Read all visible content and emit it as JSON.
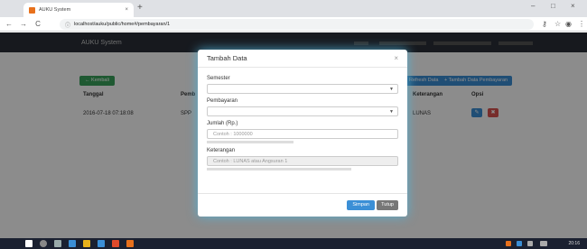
{
  "browser": {
    "tab_title": "AUKU System",
    "tab_close": "×",
    "new_tab": "+",
    "url": "localhost/auku/public/home#/pembayaran/1",
    "back": "←",
    "forward": "→",
    "reload": "C",
    "info": "ⓘ",
    "window_minimize": "–",
    "window_maximize": "□",
    "window_close": "×"
  },
  "app": {
    "brand": "AUKU System",
    "kembali_label": "← Kembali",
    "refresh_label": "Refresh Data",
    "tambah_label": "+ Tambah Data Pembayaran",
    "table": {
      "columns": [
        "Tanggal",
        "Pemb",
        "Keterangan",
        "Opsi"
      ],
      "rows": [
        {
          "tanggal": "2016-07-18 07:18:08",
          "pembayaran": "SPP",
          "keterangan": "LUNAS"
        }
      ]
    }
  },
  "modal": {
    "title": "Tambah Data",
    "close": "×",
    "fields": {
      "semester_label": "Semester",
      "pembayaran_label": "Pembayaran",
      "jumlah_label": "Jumlah (Rp.)",
      "jumlah_placeholder": "Contoh : 1000000",
      "keterangan_label": "Keterangan",
      "keterangan_placeholder": "Contoh : LUNAS atau Angsuran 1"
    },
    "save_label": "Simpan",
    "close_label": "Tutup"
  },
  "taskbar": {
    "clock": "20:16"
  },
  "colors": {
    "nav_bg": "#2a2f38",
    "modal_glow": "#50b4dc",
    "primary": "#3b8fd6",
    "success": "#3aa35b",
    "danger": "#d9534f"
  }
}
